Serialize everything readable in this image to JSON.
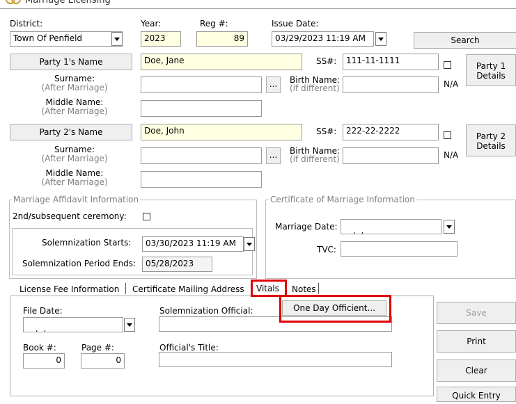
{
  "window": {
    "title": "Marriage Licensing"
  },
  "header": {
    "district_label": "District:",
    "district_value": "Town Of Penfield",
    "year_label": "Year:",
    "year_value": "2023",
    "reg_label": "Reg #:",
    "reg_value": "89",
    "issue_label": "Issue Date:",
    "issue_value": "03/29/2023 11:19 AM",
    "search_label": "Search"
  },
  "party1": {
    "name_button": "Party 1's Name",
    "name_value": "Doe, Jane",
    "ss_label": "SS#:",
    "ss_value": "111-11-1111",
    "surname_label": "Surname:",
    "surname_sub": "(After Marriage)",
    "browse_label": "...",
    "birth_label": "Birth Name:",
    "birth_sub": "(if different)",
    "na_label": "N/A",
    "middle_label": "Middle Name:",
    "middle_sub": "(After Marriage)",
    "details_line1": "Party 1",
    "details_line2": "Details"
  },
  "party2": {
    "name_button": "Party 2's Name",
    "name_value": "Doe, John",
    "ss_label": "SS#:",
    "ss_value": "222-22-2222",
    "surname_label": "Surname:",
    "surname_sub": "(After Marriage)",
    "browse_label": "...",
    "birth_label": "Birth Name:",
    "birth_sub": "(if different)",
    "na_label": "N/A",
    "middle_label": "Middle Name:",
    "middle_sub": "(After Marriage)",
    "details_line1": "Party 2",
    "details_line2": "Details"
  },
  "affidavit": {
    "title": "Marriage Affidavit Information",
    "ceremony_label": "2nd/subsequent ceremony:",
    "starts_label": "Solemnization Starts:",
    "starts_value": "03/30/2023 11:19 AM",
    "ends_label": "Solemnization Period Ends:",
    "ends_value": "05/28/2023"
  },
  "certificate": {
    "title": "Certificate of Marriage Information",
    "date_label": "Marriage Date:",
    "date_value": " /  /        :",
    "tvc_label": "TVC:"
  },
  "tabs": [
    {
      "label": "License Fee Information"
    },
    {
      "label": "Certificate Mailing Address"
    },
    {
      "label": "Vitals"
    },
    {
      "label": "Notes"
    }
  ],
  "vitals": {
    "file_date_label": "File Date:",
    "file_date_value": " /  /        :",
    "official_label": "Solemnization Official:",
    "one_day_button": "One Day Officient...",
    "book_label": "Book #:",
    "book_value": "0",
    "page_label": "Page #:",
    "page_value": "0",
    "title_label": "Official's Title:"
  },
  "actions": {
    "save": "Save",
    "print": "Print",
    "clear": "Clear",
    "quick_entry": "Quick Entry"
  },
  "colors": {
    "highlight_red": "#e00000",
    "field_yellow": "#ffffe1"
  }
}
